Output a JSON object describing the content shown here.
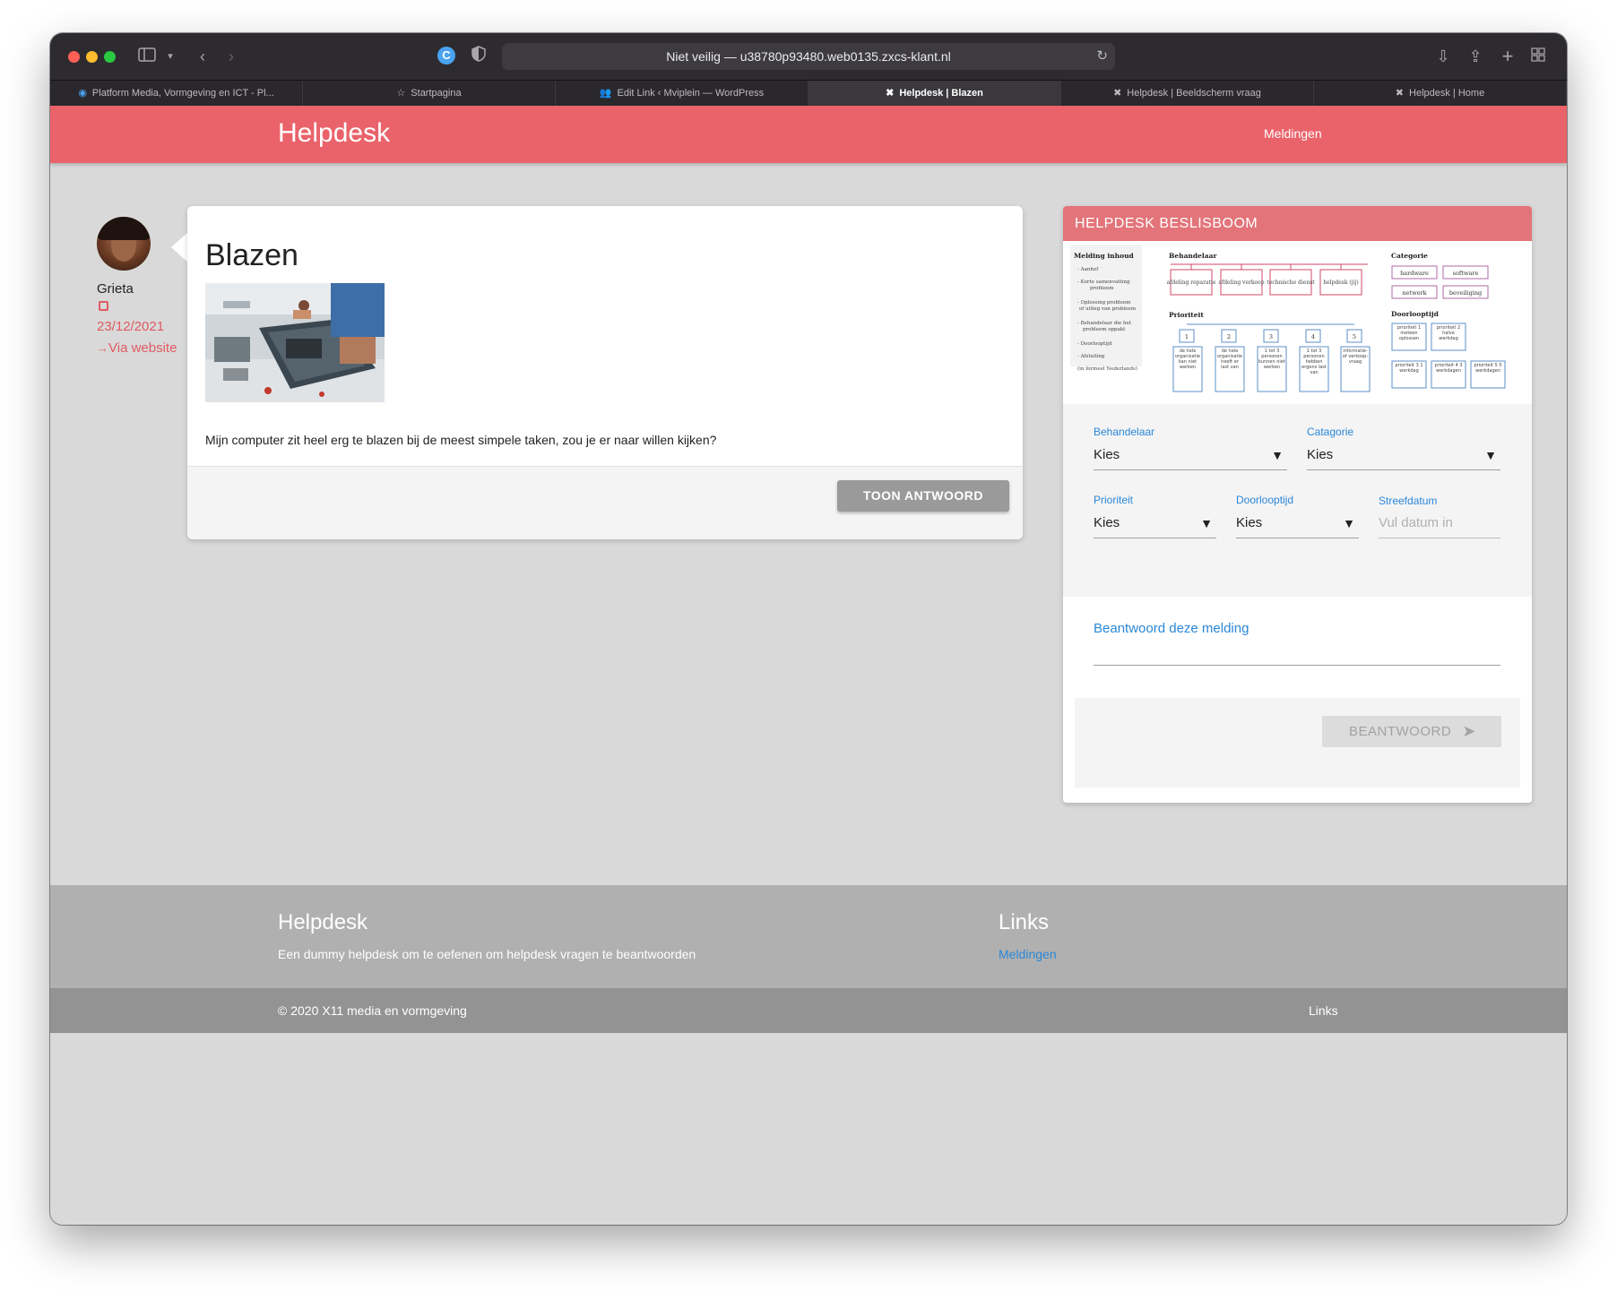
{
  "browser": {
    "url": "Niet veilig — u38780p93480.web0135.zxcs-klant.nl",
    "tabs": [
      {
        "label": "Platform Media, Vormgeving en ICT - Pl...",
        "active": false
      },
      {
        "label": "Startpagina",
        "active": false
      },
      {
        "label": "Edit Link ‹ Mviplein — WordPress",
        "active": false
      },
      {
        "label": "Helpdesk | Blazen",
        "active": true
      },
      {
        "label": "Helpdesk | Beeldscherm vraag",
        "active": false
      },
      {
        "label": "Helpdesk | Home",
        "active": false
      }
    ]
  },
  "header": {
    "brand": "Helpdesk",
    "nav_item": "Meldingen",
    "color": "#ea636a"
  },
  "author": {
    "name": "Grieta",
    "date": "23/12/2021",
    "via": "Via website"
  },
  "post": {
    "title": "Blazen",
    "text": "Mijn computer zit heel erg te blazen bij de meest simpele taken, zou je er naar willen kijken?",
    "button": "TOON ANTWOORD"
  },
  "panel": {
    "title": "HELPDESK BESLISBOOM",
    "tree": {
      "melding_title": "Melding inhoud",
      "melding_items": [
        "- Aanhef",
        "- Korte samenvatting",
        "probleem",
        "- Oplossing probleem",
        "of uitleg van probleem",
        "- Behandelaar die het",
        "probleem oppakt",
        "- Doorlooptijd",
        "- Afsluiting",
        "(in formeel Nederlands)"
      ],
      "behandelaar_title": "Behandelaar",
      "behandelaar_items": [
        "afdeling reparatie",
        "afdeling verkoop",
        "technische dienst",
        "helpdesk (jij)"
      ],
      "prioriteit_title": "Prioriteit",
      "prioriteit_nums": [
        "1",
        "2",
        "3",
        "4",
        "5"
      ],
      "prioriteit_items": [
        "de hele organisatie kan niet werken",
        "de hele organisatie heeft er last van",
        "1 tot 3 personen kunnen niet werken",
        "1 tot 3 personen hebben ergens last van",
        "informatie- of verkoop- vraag"
      ],
      "categorie_title": "Categorie",
      "categorie_items": [
        "hardware",
        "software",
        "netwerk",
        "beveiliging"
      ],
      "doorlooptijd_title": "Doorlooptijd",
      "doorlooptijd_items": [
        "prioriteit 1 meteen oplossen",
        "prioriteit 2 halve werkdag",
        "prioriteit 3 1 werkdag",
        "prioriteit 4 3 werkdagen",
        "prioriteit 5 5 werkdagen"
      ]
    },
    "fields": {
      "behandelaar_label": "Behandelaar",
      "behandelaar_value": "Kies",
      "categorie_label": "Catagorie",
      "categorie_value": "Kies",
      "prioriteit_label": "Prioriteit",
      "prioriteit_value": "Kies",
      "doorlooptijd_label": "Doorlooptijd",
      "doorlooptijd_value": "Kies",
      "streefdatum_label": "Streefdatum",
      "streefdatum_placeholder": "Vul datum in"
    },
    "answer_label": "Beantwoord deze melding",
    "answer_button": "BEANTWOORD"
  },
  "footer": {
    "title": "Helpdesk",
    "text": "Een dummy helpdesk om te oefenen om helpdesk vragen te beantwoorden",
    "links_title": "Links",
    "link": "Meldingen",
    "copyright": "© 2020 X11 media en vormgeving",
    "bottom_link": "Links"
  }
}
